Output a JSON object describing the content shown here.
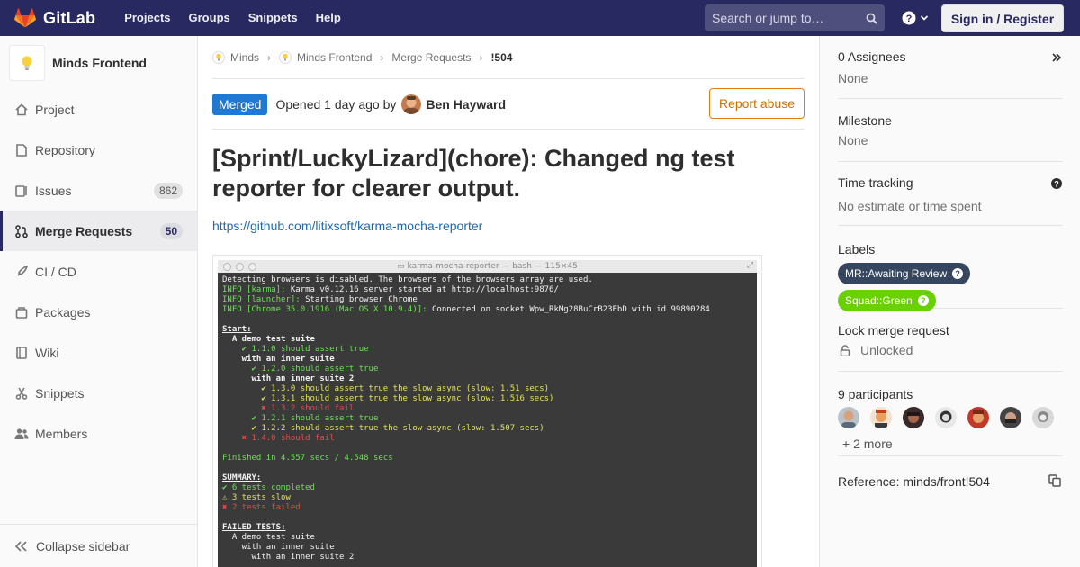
{
  "navbar": {
    "brand": "GitLab",
    "links": [
      "Projects",
      "Groups",
      "Snippets",
      "Help"
    ],
    "search_placeholder": "Search or jump to…",
    "signin_label": "Sign in / Register"
  },
  "sidebar": {
    "project_name": "Minds Frontend",
    "items": [
      {
        "label": "Project",
        "icon": "home-icon"
      },
      {
        "label": "Repository",
        "icon": "doc-icon"
      },
      {
        "label": "Issues",
        "icon": "issues-icon",
        "count": "862"
      },
      {
        "label": "Merge Requests",
        "icon": "merge-request-icon",
        "count": "50",
        "active": true
      },
      {
        "label": "CI / CD",
        "icon": "rocket-icon"
      },
      {
        "label": "Packages",
        "icon": "package-icon"
      },
      {
        "label": "Wiki",
        "icon": "book-icon"
      },
      {
        "label": "Snippets",
        "icon": "scissors-icon"
      },
      {
        "label": "Members",
        "icon": "users-icon"
      }
    ],
    "collapse_label": "Collapse sidebar"
  },
  "breadcrumb": [
    "Minds",
    "Minds Frontend",
    "Merge Requests",
    "!504"
  ],
  "mr": {
    "status": "Merged",
    "opened_text": "Opened 1 day ago by",
    "author": "Ben Hayward",
    "report_label": "Report abuse",
    "title": "[Sprint/LuckyLizard](chore): Changed ng test reporter for clearer output.",
    "link": "https://github.com/litixsoft/karma-mocha-reporter"
  },
  "terminal": {
    "title": "karma-mocha-reporter — bash — 115×45",
    "lines": [
      {
        "t": "Detecting browsers is disabled. The browsers of the browsers array are used.",
        "c": "white"
      },
      {
        "t": "INFO [karma]: ",
        "c": "green",
        "rest": "Karma v0.12.16 server started at http://localhost:9876/"
      },
      {
        "t": "INFO [launcher]: ",
        "c": "green",
        "rest": "Starting browser Chrome"
      },
      {
        "t": "INFO [Chrome 35.0.1916 (Mac OS X 10.9.4)]: ",
        "c": "green",
        "rest": "Connected on socket Wpw_RkMg28BuCrB23EbD with id 99890284"
      },
      {
        "t": "",
        "c": "white"
      },
      {
        "t": "Start:",
        "c": "under"
      },
      {
        "t": "  A demo test suite",
        "c": "bold"
      },
      {
        "t": "    ✔ 1.1.0 should assert true",
        "c": "green"
      },
      {
        "t": "    with an inner suite",
        "c": "bold"
      },
      {
        "t": "      ✔ 1.2.0 should assert true",
        "c": "green"
      },
      {
        "t": "      with an inner suite 2",
        "c": "bold"
      },
      {
        "t": "        ✔ 1.3.0 should assert true the slow async (slow: 1.51 secs)",
        "c": "yellow"
      },
      {
        "t": "        ✔ 1.3.1 should assert true the slow async (slow: 1.516 secs)",
        "c": "yellow"
      },
      {
        "t": "        ✖ 1.3.2 should fail",
        "c": "red"
      },
      {
        "t": "      ✔ 1.2.1 should assert true",
        "c": "green"
      },
      {
        "t": "      ✔ 1.2.2 should assert true the slow async (slow: 1.507 secs)",
        "c": "yellow"
      },
      {
        "t": "    ✖ 1.4.0 should fail",
        "c": "red"
      },
      {
        "t": "",
        "c": "white"
      },
      {
        "t": "Finished in 4.557 secs / 4.548 secs",
        "c": "green"
      },
      {
        "t": "",
        "c": "white"
      },
      {
        "t": "SUMMARY:",
        "c": "under"
      },
      {
        "t": "✔ 6 tests completed",
        "c": "green"
      },
      {
        "t": "⚠ 3 tests slow",
        "c": "yellow"
      },
      {
        "t": "✖ 2 tests failed",
        "c": "red"
      },
      {
        "t": "",
        "c": "white"
      },
      {
        "t": "FAILED TESTS:",
        "c": "under"
      },
      {
        "t": "  A demo test suite",
        "c": "white"
      },
      {
        "t": "    with an inner suite",
        "c": "white"
      },
      {
        "t": "      with an inner suite 2",
        "c": "white"
      }
    ]
  },
  "right_sidebar": {
    "assignees_title": "0 Assignees",
    "assignees_value": "None",
    "milestone_title": "Milestone",
    "milestone_value": "None",
    "time_title": "Time tracking",
    "time_value": "No estimate or time spent",
    "labels_title": "Labels",
    "labels": [
      {
        "text": "MR::Awaiting Review",
        "color": "#36465f"
      },
      {
        "text": "Squad::Green",
        "color": "#69d100"
      }
    ],
    "lock_title": "Lock merge request",
    "lock_value": "Unlocked",
    "participants_title": "9 participants",
    "participants_more": "+ 2 more",
    "reference": "Reference: minds/front!504"
  }
}
